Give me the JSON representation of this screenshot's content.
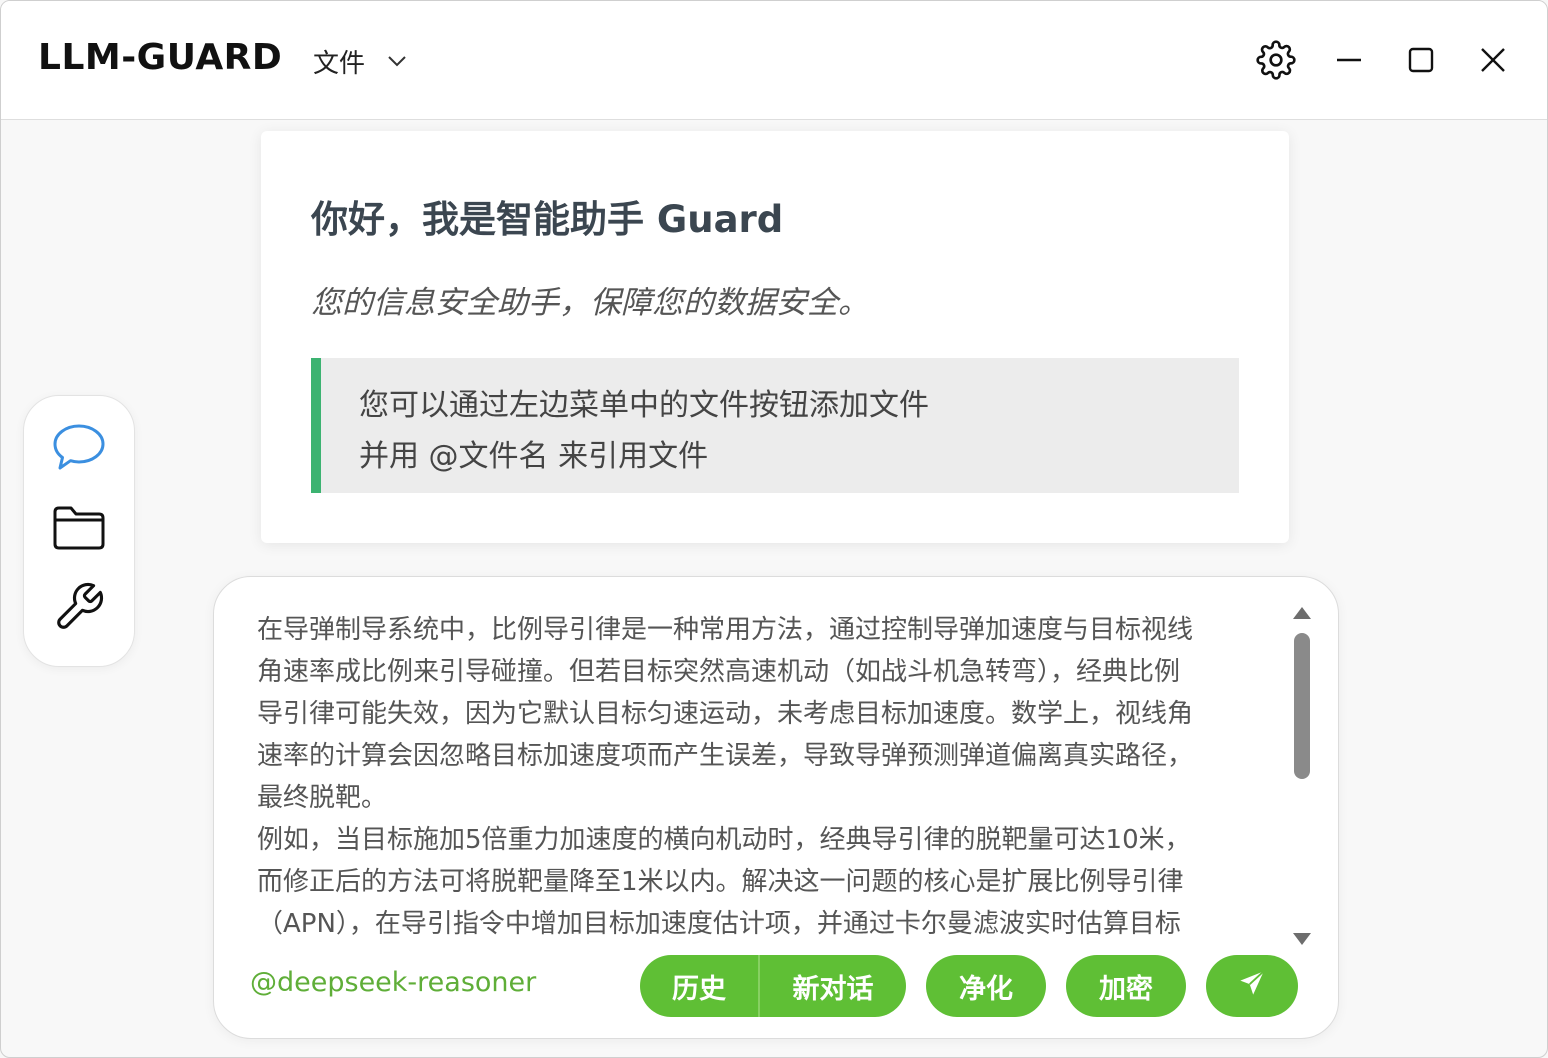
{
  "app": {
    "title": "LLM-GUARD"
  },
  "menu": {
    "file_label": "文件"
  },
  "window_controls": {
    "icons": [
      "gear-icon",
      "minimize-icon",
      "maximize-icon",
      "close-icon"
    ]
  },
  "welcome": {
    "title": "你好，我是智能助手 Guard",
    "subtitle": "您的信息安全助手，保障您的数据安全。",
    "tip_line1": "您可以通过左边菜单中的文件按钮添加文件",
    "tip_line2": "并用 @文件名 来引用文件",
    "accent_color": "#3cb371"
  },
  "sidebar": {
    "items": [
      {
        "icon": "chat-bubble-icon",
        "color": "#3b8fe0"
      },
      {
        "icon": "folder-icon",
        "color": "#111111"
      },
      {
        "icon": "wrench-icon",
        "color": "#111111"
      }
    ]
  },
  "composer": {
    "message": "在导弹制导系统中，比例导引律是一种常用方法，通过控制导弹加速度与目标视线\n角速率成比例来引导碰撞。但若目标突然高速机动（如战斗机急转弯），经典比例\n导引律可能失效，因为它默认目标匀速运动，未考虑目标加速度。数学上，视线角\n速率的计算会因忽略目标加速度项而产生误差，导致导弹预测弹道偏离真实路径，\n最终脱靶。\n例如，当目标施加5倍重力加速度的横向机动时，经典导引律的脱靶量可达10米，\n而修正后的方法可将脱靶量降至1米以内。解决这一问题的核心是扩展比例导引律\n（APN），在导引指令中增加目标加速度估计项，并通过卡尔曼滤波实时估算目标",
    "model": "@deepseek-reasoner",
    "history_label": "历史",
    "new_chat_label": "新对话",
    "clean_label": "净化",
    "encrypt_label": "加密",
    "send_icon": "send-icon",
    "button_color": "#5fbf35"
  }
}
